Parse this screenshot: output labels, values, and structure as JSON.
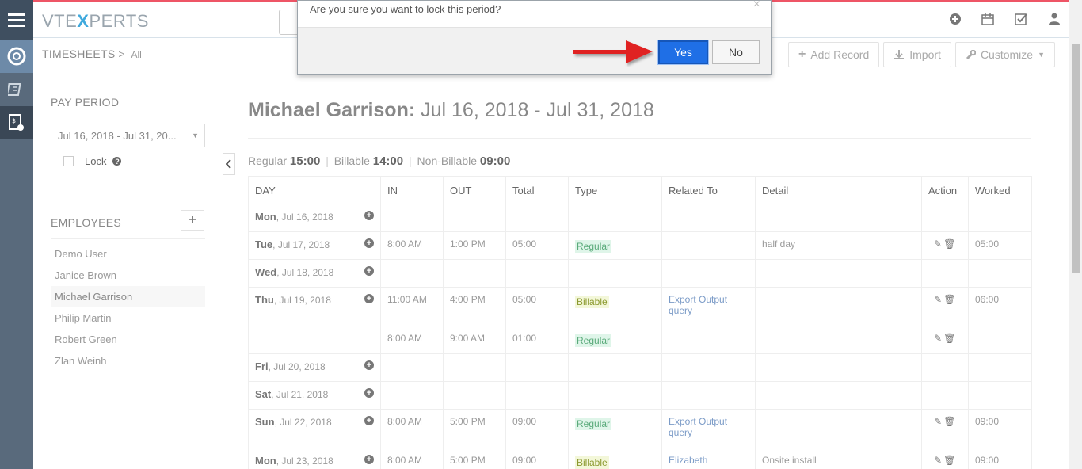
{
  "app": {
    "logo_prefix": "VTE",
    "logo_x": "X",
    "logo_suffix": "PERTS"
  },
  "breadcrumb": {
    "module": "TIMESHEETS",
    "sep": ">",
    "view": "All"
  },
  "actions": {
    "add_record": "Add Record",
    "import": "Import",
    "customize": "Customize"
  },
  "left": {
    "pay_period_title": "PAY PERIOD",
    "pay_period_value": "Jul 16, 2018 - Jul 31, 20...",
    "lock_label": "Lock",
    "employees_title": "EMPLOYEES",
    "employees": [
      "Demo User",
      "Janice Brown",
      "Michael Garrison",
      "Philip Martin",
      "Robert Green",
      "Zlan Weinh"
    ]
  },
  "main": {
    "employee_name": "Michael Garrison:",
    "period": "Jul 16, 2018 - Jul 31, 2018",
    "summary": {
      "regular_label": "Regular",
      "regular_value": "15:00",
      "billable_label": "Billable",
      "billable_value": "14:00",
      "nonbillable_label": "Non-Billable",
      "nonbillable_value": "09:00",
      "separator": "|"
    },
    "columns": [
      "DAY",
      "IN",
      "OUT",
      "Total",
      "Type",
      "Related To",
      "Detail",
      "Action",
      "Worked"
    ],
    "rows": [
      {
        "day_bold": "Mon",
        "day_rest": ", Jul 16, 2018"
      },
      {
        "day_bold": "Tue",
        "day_rest": ", Jul 17, 2018",
        "in": "8:00 AM",
        "out": "1:00 PM",
        "total": "05:00",
        "type": "Regular",
        "related": "",
        "detail": "half day",
        "worked": "05:00"
      },
      {
        "day_bold": "Wed",
        "day_rest": ", Jul 18, 2018"
      },
      {
        "day_bold": "Thu",
        "day_rest": ", Jul 19, 2018",
        "in": "11:00 AM",
        "out": "4:00 PM",
        "total": "05:00",
        "type": "Billable",
        "related": "Export Output query",
        "detail": "",
        "worked": "06:00"
      },
      {
        "in": "8:00 AM",
        "out": "9:00 AM",
        "total": "01:00",
        "type": "Regular",
        "related": "",
        "detail": ""
      },
      {
        "day_bold": "Fri",
        "day_rest": ", Jul 20, 2018"
      },
      {
        "day_bold": "Sat",
        "day_rest": ", Jul 21, 2018"
      },
      {
        "day_bold": "Sun",
        "day_rest": ", Jul 22, 2018",
        "in": "8:00 AM",
        "out": "5:00 PM",
        "total": "09:00",
        "type": "Regular",
        "related": "Export Output query",
        "detail": "",
        "worked": "09:00"
      },
      {
        "day_bold": "Mon",
        "day_rest": ", Jul 23, 2018",
        "in": "8:00 AM",
        "out": "5:00 PM",
        "total": "09:00",
        "type": "Billable",
        "related": "Elizabeth",
        "detail": "Onsite install",
        "worked": "09:00"
      }
    ]
  },
  "dialog": {
    "message": "Are you sure you want to lock this period?",
    "yes": "Yes",
    "no": "No",
    "close": "×"
  },
  "icons": {
    "plus": "+",
    "edit": "✎",
    "trash": "🗑"
  },
  "colors": {
    "accent": "#3fa9dd",
    "primary_button": "#1f6fe6",
    "arrow": "#e02020",
    "rail": "#596a7c"
  }
}
